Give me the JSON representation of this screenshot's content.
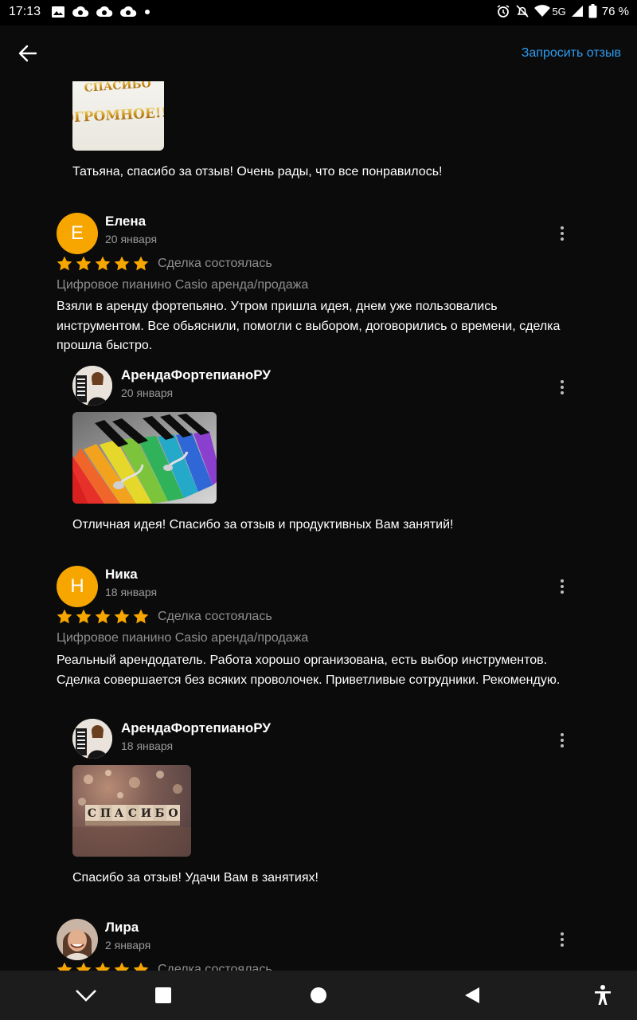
{
  "status_bar": {
    "time": "17:13",
    "network": "5G",
    "battery": "76 %"
  },
  "header": {
    "back_icon": "arrow-left-icon",
    "request_review": "Запросить отзыв"
  },
  "top_reply": {
    "image_text": "СПАСИБО ОГРОМНОЕ!!!",
    "text": "Татьяна, спасибо за отзыв! Очень рады, что все понравилось!"
  },
  "reviews": [
    {
      "avatar_letter": "Е",
      "name": "Елена",
      "date": "20 января",
      "rating": 5,
      "deal_status": "Сделка состоялась",
      "product": "Цифровое пианино Casio аренда/продажа",
      "text": "Взяли в аренду фортепьяно. Утром пришла идея, днем уже пользовались инструментом. Все обьяснили, помогли с выбором, договорились о времени, сделка прошла быстро.",
      "reply": {
        "shop_name": "АрендаФортепианоРУ",
        "date": "20 января",
        "text": "Отличная идея! Спасибо за отзыв и продуктивных Вам занятий!"
      }
    },
    {
      "avatar_letter": "Н",
      "name": "Ника",
      "date": "18 января",
      "rating": 5,
      "deal_status": "Сделка состоялась",
      "product": "Цифровое пианино Casio аренда/продажа",
      "text": "Реальный арендодатель. Работа хорошо организована, есть выбор инструментов. Сделка совершается без всяких проволочек. Приветливые сотрудники. Рекомендую.",
      "reply": {
        "shop_name": "АрендаФортепианоРУ",
        "date": "18 января",
        "image_text": "СПАСИБО",
        "text": "Спасибо за отзыв! Удачи Вам в занятиях!"
      }
    },
    {
      "name": "Лира",
      "date": "2 января",
      "rating": 5,
      "deal_status": "Сделка состоялась"
    }
  ],
  "colors": {
    "accent": "#2d9cf0",
    "star": "#f7a600",
    "avatar_bg": "#f7a600",
    "background": "#0b0b0b"
  },
  "nav_bar": {
    "icons": [
      "chevron-down-icon",
      "square-icon",
      "circle-home-icon",
      "triangle-back-icon",
      "accessibility-icon"
    ]
  }
}
